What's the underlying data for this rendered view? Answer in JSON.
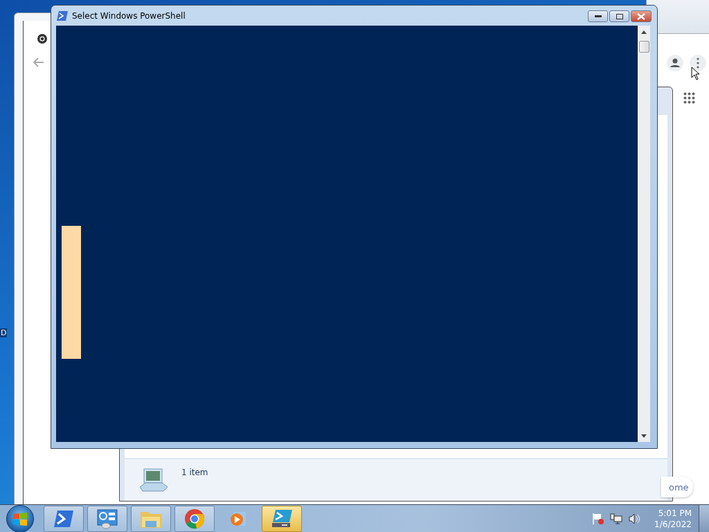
{
  "desktop_icon": {
    "label": "D"
  },
  "browser": {
    "link_text": "ome"
  },
  "explorer": {
    "status_bar": {
      "text": "1 item"
    }
  },
  "powershell": {
    "title": "Select Windows PowerShell"
  },
  "taskbar": {
    "items": [
      {
        "kind": "powershell",
        "running": true,
        "selected": false
      },
      {
        "kind": "control-panel",
        "running": true,
        "selected": false
      },
      {
        "kind": "explorer",
        "running": true,
        "selected": false
      },
      {
        "kind": "chrome",
        "running": true,
        "selected": false
      },
      {
        "kind": "media-player",
        "running": false,
        "selected": false
      },
      {
        "kind": "powershell-ise",
        "running": true,
        "selected": true
      }
    ],
    "clock": {
      "time": "5:01 PM",
      "date": "1/6/2022"
    }
  }
}
